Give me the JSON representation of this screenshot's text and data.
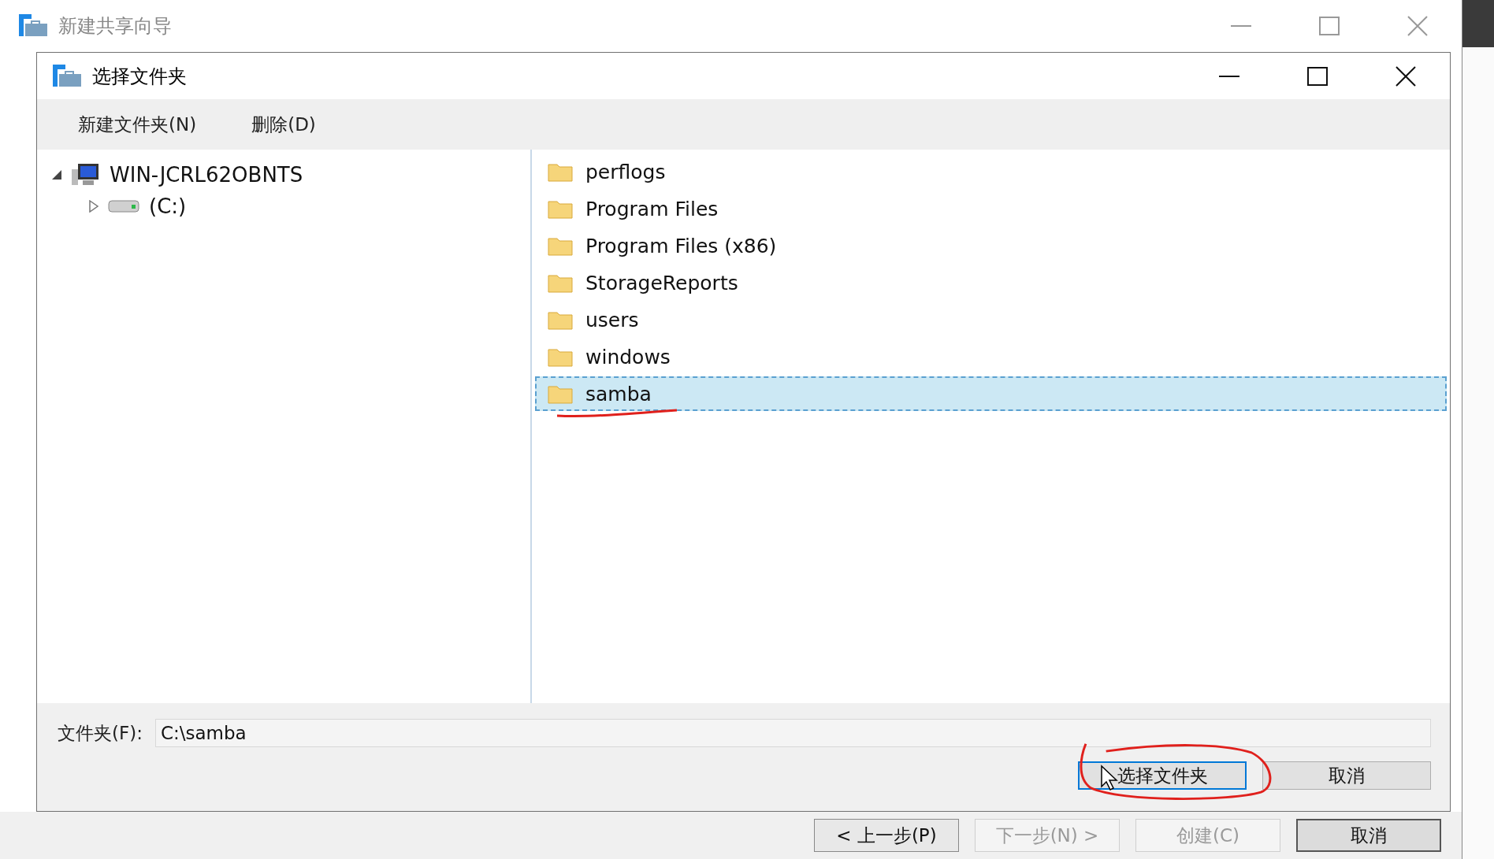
{
  "wizard": {
    "title": "新建共享向导",
    "buttons": [
      {
        "label": "< 上一步(P)",
        "disabled": false,
        "default": false
      },
      {
        "label": "下一步(N) >",
        "disabled": true,
        "default": false
      },
      {
        "label": "创建(C)",
        "disabled": true,
        "default": false
      },
      {
        "label": "取消",
        "disabled": false,
        "default": true
      }
    ]
  },
  "dialog": {
    "title": "选择文件夹",
    "toolbar": [
      "新建文件夹(N)",
      "删除(D)"
    ],
    "tree": [
      {
        "label": "WIN-JCRL62OBNTS",
        "kind": "computer",
        "expanded": true,
        "children": [
          {
            "label": "(C:)",
            "kind": "drive",
            "expanded": false
          }
        ]
      }
    ],
    "folders": [
      {
        "name": "perflogs",
        "selected": false
      },
      {
        "name": "Program Files",
        "selected": false
      },
      {
        "name": "Program Files (x86)",
        "selected": false
      },
      {
        "name": "StorageReports",
        "selected": false
      },
      {
        "name": "users",
        "selected": false
      },
      {
        "name": "windows",
        "selected": false
      },
      {
        "name": "samba",
        "selected": true
      }
    ],
    "folder_field": {
      "label": "文件夹(F):",
      "value": "C:\\samba"
    },
    "buttons": [
      {
        "label": "选择文件夹",
        "focused": true
      },
      {
        "label": "取消",
        "focused": false
      }
    ]
  }
}
